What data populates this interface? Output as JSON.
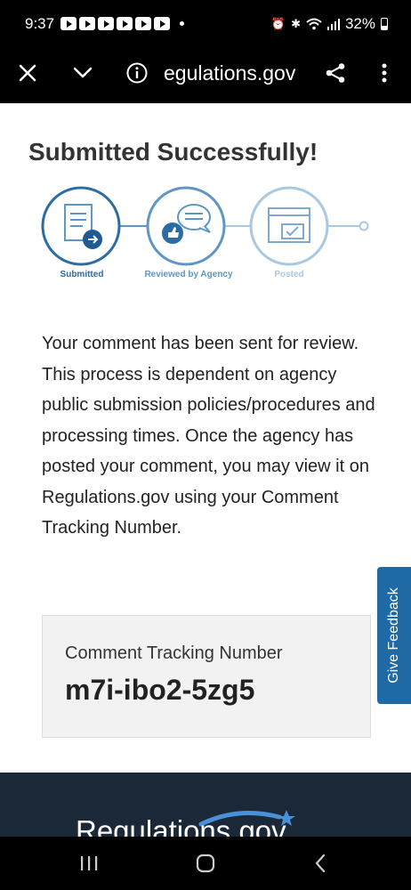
{
  "status_bar": {
    "time": "9:37",
    "battery": "32%",
    "notification_icons": [
      "play-icon",
      "play-icon",
      "play-icon",
      "play-icon",
      "play-icon",
      "play-icon"
    ]
  },
  "browser": {
    "url": "egulations.gov",
    "icons": [
      "close-icon",
      "chevron-down-icon",
      "info-icon",
      "share-icon",
      "more-vert-icon"
    ]
  },
  "page": {
    "title": "Submitted Successfully!",
    "steps": [
      {
        "label": "Submitted",
        "color": "#2b6ca3"
      },
      {
        "label": "Reviewed by Agency",
        "color": "#5e96c6"
      },
      {
        "label": "Posted",
        "color": "#a9c8e2"
      }
    ],
    "message": "Your comment has been sent for review. This process is dependent on agency public submission policies/procedures and processing times. Once the agency has posted your comment, you may view it on Regulations.gov using your Comment Tracking Number.",
    "tracking": {
      "label": "Comment Tracking Number",
      "number": "m7i-ibo2-5zg5"
    },
    "feedback_tab": "Give Feedback"
  },
  "footer": {
    "logo_text": "Regulations.gov"
  },
  "colors": {
    "accent": "#1f6aa5",
    "footer_bg": "#1b2838",
    "step_submitted": "#2b6ca3",
    "step_reviewed": "#5e96c6",
    "step_posted": "#a9c8e2"
  }
}
